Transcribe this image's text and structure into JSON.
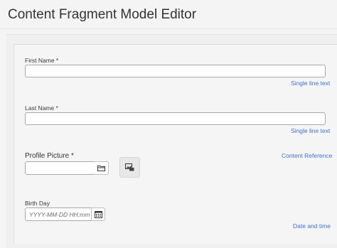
{
  "header": {
    "title": "Content Fragment Model Editor"
  },
  "form": {
    "fields": [
      {
        "label": "First Name *",
        "type_label": "Single line text",
        "value": ""
      },
      {
        "label": "Last Name *",
        "type_label": "Single line text",
        "value": ""
      },
      {
        "label": "Profile Picture *",
        "type_label": "Content Reference",
        "value": "",
        "browse_icon": "folder-icon",
        "thumbnail_icon": "image-icon"
      },
      {
        "label": "Birth Day",
        "type_label": "Date and time",
        "value": "",
        "placeholder": "YYYY-MM-DD HH:mm",
        "picker_icon": "calendar-icon"
      }
    ]
  },
  "colors": {
    "link": "#3e72c5",
    "background": "#f4f4f4",
    "input_border": "#a8a8a8"
  }
}
